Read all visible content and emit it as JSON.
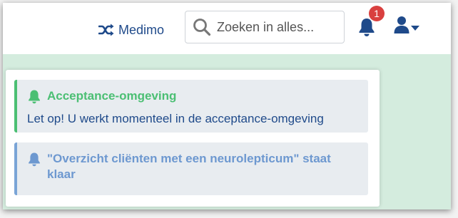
{
  "header": {
    "switch_label": "Medimo",
    "search_placeholder": "Zoeken in alles...",
    "notification_count": "1"
  },
  "notifications": [
    {
      "title": "Acceptance-omgeving",
      "body": "Let op! U werkt momenteel in de acceptance-omgeving",
      "color": "#4bbf73"
    },
    {
      "title": "\"Overzicht cliënten met een neurolepticum\" staat klaar",
      "color": "#6d98d0"
    }
  ],
  "colors": {
    "brand": "#1f4a8a",
    "success": "#4bbf73",
    "info": "#6d98d0",
    "badge": "#d9403f",
    "page_background": "#d4ecde"
  },
  "icons": [
    "shuffle-icon",
    "search-icon",
    "bell-icon",
    "user-icon",
    "caret-down-icon"
  ]
}
